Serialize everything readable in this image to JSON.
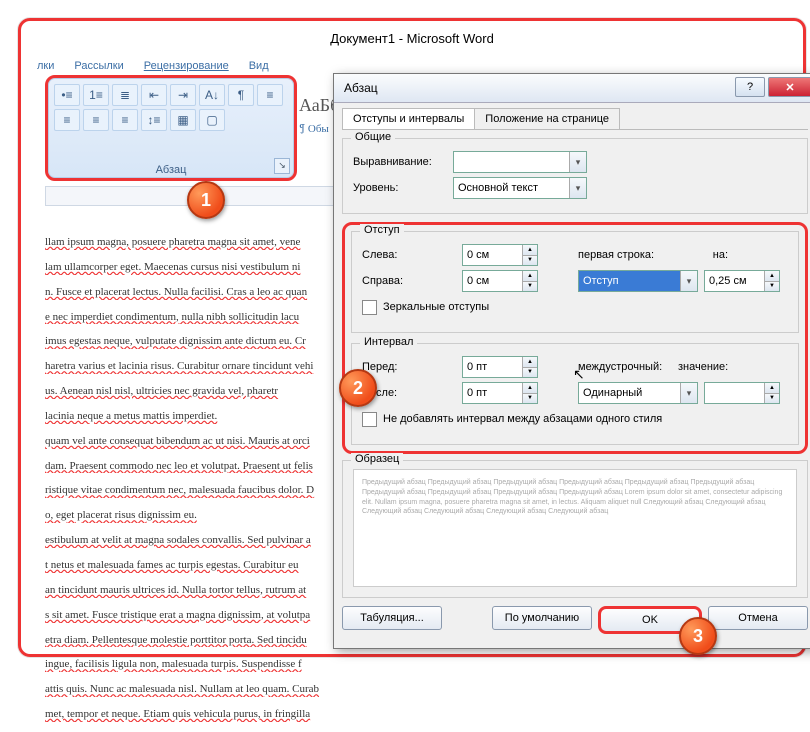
{
  "window": {
    "title": "Документ1  -  Microsoft Word"
  },
  "ribbon": {
    "tabs": [
      "лки",
      "Рассылки",
      "Рецензирование",
      "Вид"
    ],
    "group_label": "Абзац",
    "styles_preview": "АаБб",
    "styles_preview2": "¶ Обы"
  },
  "doc_paragraphs": [
    "llam ipsum magna, posuere pharetra magna sit amet, vene",
    "lam ullamcorper eget. Maecenas cursus nisi vestibulum ni",
    "n. Fusce et placerat lectus. Nulla facilisi. Cras a leo ac quan",
    "e nec imperdiet condimentum, nulla nibh sollicitudin lacu",
    "imus egestas neque, vulputate dignissim ante dictum eu. Cr",
    "haretra varius et lacinia risus. Curabitur ornare tincidunt vehi",
    "us. Aenean nisl nisl, ultricies nec gravida vel, pharetr",
    "lacinia neque a metus mattis imperdiet.",
    "quam vel ante consequat bibendum ac ut nisi. Mauris at orci",
    "dam. Praesent commodo nec leo et volutpat. Praesent ut felis",
    "ristique vitae condimentum nec, malesuada faucibus dolor. D",
    "o, eget placerat risus dignissim eu.",
    "estibulum at velit at magna sodales convallis. Sed pulvinar a",
    "t netus et malesuada fames ac turpis egestas. Curabitur eu",
    "an tincidunt mauris ultrices id. Nulla tortor tellus, rutrum at",
    "s sit amet. Fusce tristique erat a magna dignissim, at volutpa",
    "etra diam. Pellentesque molestie porttitor porta. Sed tincidu",
    "ingue, facilisis ligula non, malesuada turpis. Suspendisse f",
    "attis quis. Nunc ac malesuada nisl. Nullam at leo quam. Curab",
    "met, tempor et neque. Etiam quis vehicula purus, in fringilla"
  ],
  "dialog": {
    "title": "Абзац",
    "tabs": {
      "indents": "Отступы и интервалы",
      "position": "Положение на странице"
    },
    "general": {
      "legend": "Общие",
      "alignment_label": "Выравнивание:",
      "alignment_value": "",
      "level_label": "Уровень:",
      "level_value": "Основной текст"
    },
    "indent": {
      "legend": "Отступ",
      "left_label": "Слева:",
      "left_value": "0 см",
      "right_label": "Справа:",
      "right_value": "0 см",
      "first_line_label": "первая строка:",
      "first_line_value": "Отступ",
      "by_label": "на:",
      "by_value": "0,25 см",
      "mirror_label": "Зеркальные отступы"
    },
    "spacing": {
      "legend": "Интервал",
      "before_label": "Перед:",
      "before_value": "0 пт",
      "after_label": "После:",
      "after_value": "0 пт",
      "line_label": "междустрочный:",
      "line_value": "Одинарный",
      "at_label": "значение:",
      "at_value": "",
      "nospace_label": "Не добавлять интервал между абзацами одного стиля"
    },
    "preview": {
      "legend": "Образец",
      "text": "Предыдущий абзац Предыдущий абзац Предыдущий абзац Предыдущий абзац Предыдущий абзац Предыдущий абзац Предыдущий абзац Предыдущий абзац Предыдущий абзац Предыдущий абзац\n\nLorem ipsum dolor sit amet, consectetur adipiscing elit. Nullam ipsum magna, posuere pharetra magna sit amet, in lectus. Aliquam aliquet null\n\nСледующий абзац Следующий абзац Следующий абзац Следующий абзац Следующий абзац Следующий абзац"
    },
    "buttons": {
      "tabs": "Табуляция...",
      "default": "По умолчанию",
      "ok": "OK",
      "cancel": "Отмена"
    }
  },
  "badges": {
    "b1": "1",
    "b2": "2",
    "b3": "3"
  }
}
